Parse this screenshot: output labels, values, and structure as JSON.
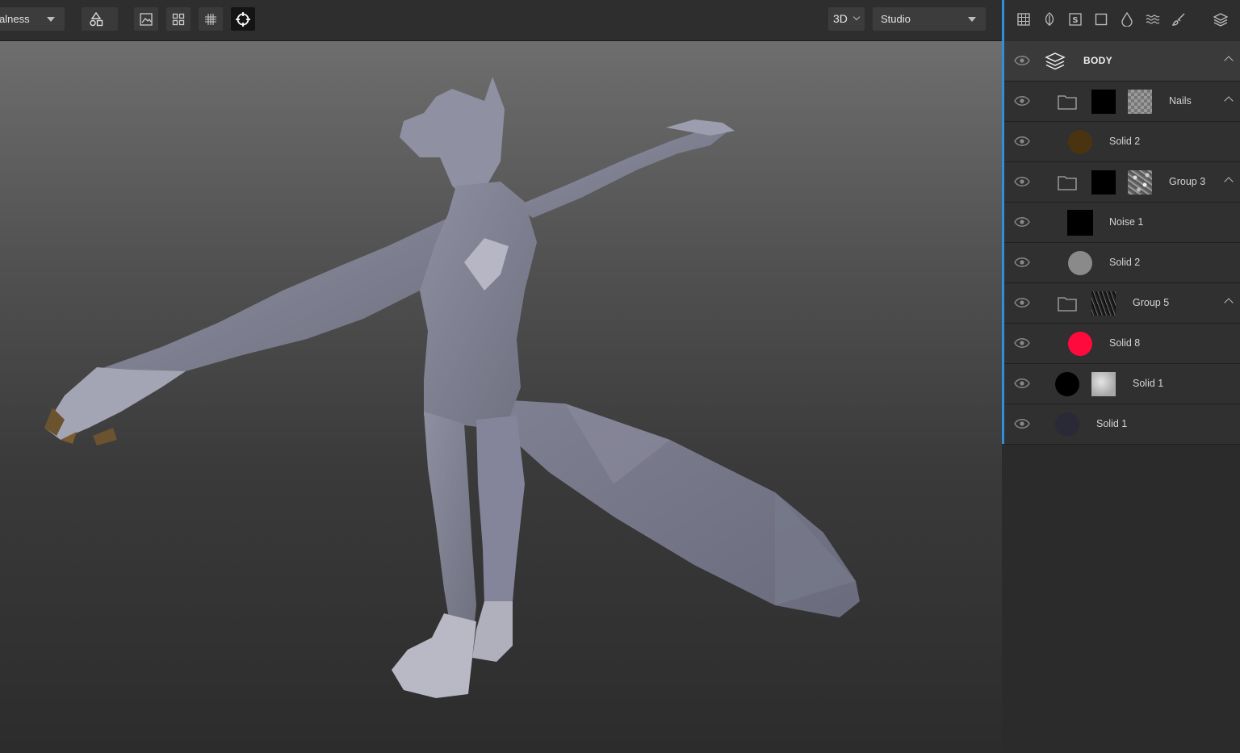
{
  "toolbar": {
    "channel_select": "alness",
    "view_mode": "3D",
    "environment": "Studio"
  },
  "layers": {
    "root": {
      "name": "BODY"
    },
    "items": [
      {
        "name": "Nails"
      },
      {
        "name": "Solid 2",
        "color": "#4a3410"
      },
      {
        "name": "Group 3"
      },
      {
        "name": "Noise 1"
      },
      {
        "name": "Solid 2",
        "color": "#8a8a8a"
      },
      {
        "name": "Group 5"
      },
      {
        "name": "Solid 8",
        "color": "#ff0a3c"
      },
      {
        "name": "Solid 1",
        "color": "#000000"
      },
      {
        "name": "Solid 1",
        "color": "#2a2a36"
      }
    ]
  },
  "panel_tabs": [
    "grid-icon",
    "leaf-icon",
    "s-icon",
    "square-icon",
    "drop-icon",
    "waves-icon",
    "brush-icon",
    "layers-icon"
  ]
}
